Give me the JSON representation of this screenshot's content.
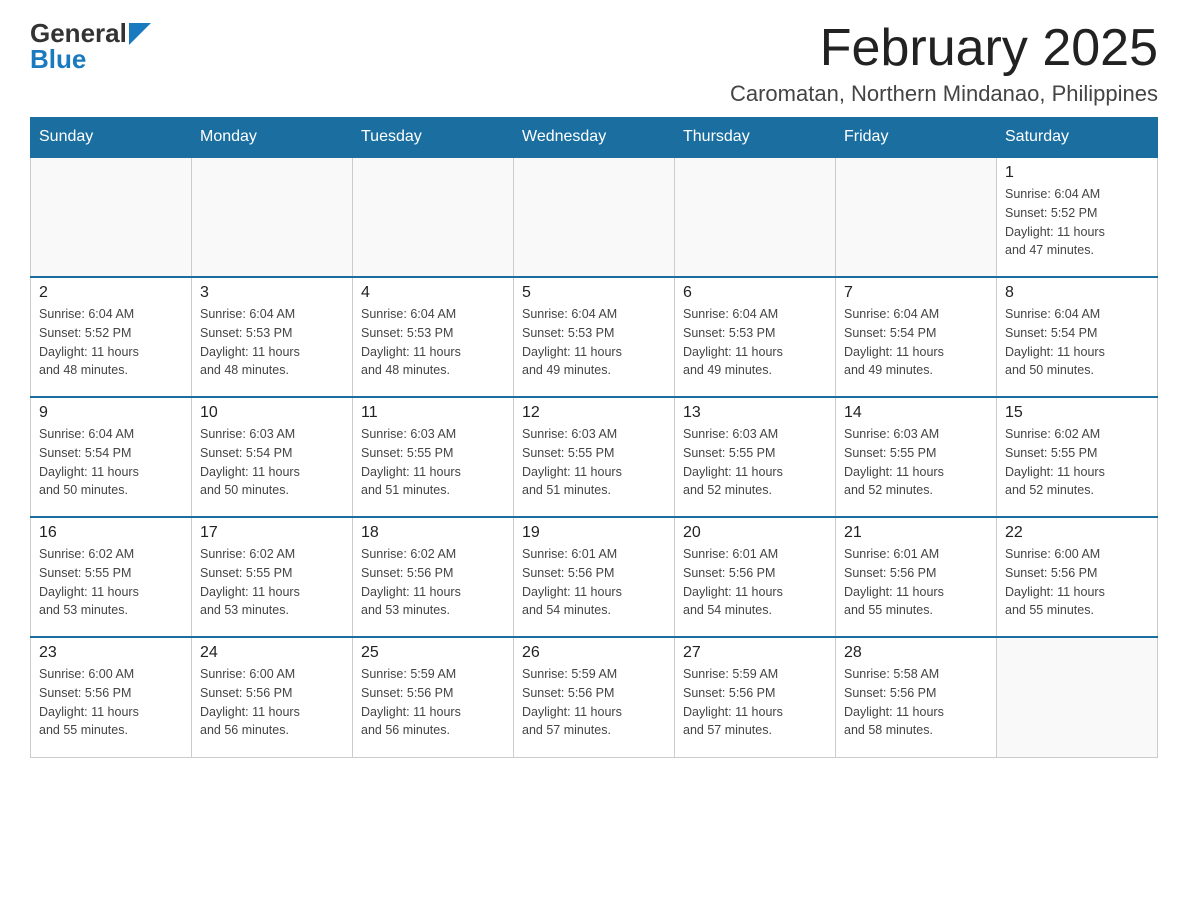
{
  "header": {
    "logo_general": "General",
    "logo_blue": "Blue",
    "month_title": "February 2025",
    "location": "Caromatan, Northern Mindanao, Philippines"
  },
  "weekdays": [
    "Sunday",
    "Monday",
    "Tuesday",
    "Wednesday",
    "Thursday",
    "Friday",
    "Saturday"
  ],
  "weeks": [
    [
      {
        "day": "",
        "info": ""
      },
      {
        "day": "",
        "info": ""
      },
      {
        "day": "",
        "info": ""
      },
      {
        "day": "",
        "info": ""
      },
      {
        "day": "",
        "info": ""
      },
      {
        "day": "",
        "info": ""
      },
      {
        "day": "1",
        "info": "Sunrise: 6:04 AM\nSunset: 5:52 PM\nDaylight: 11 hours\nand 47 minutes."
      }
    ],
    [
      {
        "day": "2",
        "info": "Sunrise: 6:04 AM\nSunset: 5:52 PM\nDaylight: 11 hours\nand 48 minutes."
      },
      {
        "day": "3",
        "info": "Sunrise: 6:04 AM\nSunset: 5:53 PM\nDaylight: 11 hours\nand 48 minutes."
      },
      {
        "day": "4",
        "info": "Sunrise: 6:04 AM\nSunset: 5:53 PM\nDaylight: 11 hours\nand 48 minutes."
      },
      {
        "day": "5",
        "info": "Sunrise: 6:04 AM\nSunset: 5:53 PM\nDaylight: 11 hours\nand 49 minutes."
      },
      {
        "day": "6",
        "info": "Sunrise: 6:04 AM\nSunset: 5:53 PM\nDaylight: 11 hours\nand 49 minutes."
      },
      {
        "day": "7",
        "info": "Sunrise: 6:04 AM\nSunset: 5:54 PM\nDaylight: 11 hours\nand 49 minutes."
      },
      {
        "day": "8",
        "info": "Sunrise: 6:04 AM\nSunset: 5:54 PM\nDaylight: 11 hours\nand 50 minutes."
      }
    ],
    [
      {
        "day": "9",
        "info": "Sunrise: 6:04 AM\nSunset: 5:54 PM\nDaylight: 11 hours\nand 50 minutes."
      },
      {
        "day": "10",
        "info": "Sunrise: 6:03 AM\nSunset: 5:54 PM\nDaylight: 11 hours\nand 50 minutes."
      },
      {
        "day": "11",
        "info": "Sunrise: 6:03 AM\nSunset: 5:55 PM\nDaylight: 11 hours\nand 51 minutes."
      },
      {
        "day": "12",
        "info": "Sunrise: 6:03 AM\nSunset: 5:55 PM\nDaylight: 11 hours\nand 51 minutes."
      },
      {
        "day": "13",
        "info": "Sunrise: 6:03 AM\nSunset: 5:55 PM\nDaylight: 11 hours\nand 52 minutes."
      },
      {
        "day": "14",
        "info": "Sunrise: 6:03 AM\nSunset: 5:55 PM\nDaylight: 11 hours\nand 52 minutes."
      },
      {
        "day": "15",
        "info": "Sunrise: 6:02 AM\nSunset: 5:55 PM\nDaylight: 11 hours\nand 52 minutes."
      }
    ],
    [
      {
        "day": "16",
        "info": "Sunrise: 6:02 AM\nSunset: 5:55 PM\nDaylight: 11 hours\nand 53 minutes."
      },
      {
        "day": "17",
        "info": "Sunrise: 6:02 AM\nSunset: 5:55 PM\nDaylight: 11 hours\nand 53 minutes."
      },
      {
        "day": "18",
        "info": "Sunrise: 6:02 AM\nSunset: 5:56 PM\nDaylight: 11 hours\nand 53 minutes."
      },
      {
        "day": "19",
        "info": "Sunrise: 6:01 AM\nSunset: 5:56 PM\nDaylight: 11 hours\nand 54 minutes."
      },
      {
        "day": "20",
        "info": "Sunrise: 6:01 AM\nSunset: 5:56 PM\nDaylight: 11 hours\nand 54 minutes."
      },
      {
        "day": "21",
        "info": "Sunrise: 6:01 AM\nSunset: 5:56 PM\nDaylight: 11 hours\nand 55 minutes."
      },
      {
        "day": "22",
        "info": "Sunrise: 6:00 AM\nSunset: 5:56 PM\nDaylight: 11 hours\nand 55 minutes."
      }
    ],
    [
      {
        "day": "23",
        "info": "Sunrise: 6:00 AM\nSunset: 5:56 PM\nDaylight: 11 hours\nand 55 minutes."
      },
      {
        "day": "24",
        "info": "Sunrise: 6:00 AM\nSunset: 5:56 PM\nDaylight: 11 hours\nand 56 minutes."
      },
      {
        "day": "25",
        "info": "Sunrise: 5:59 AM\nSunset: 5:56 PM\nDaylight: 11 hours\nand 56 minutes."
      },
      {
        "day": "26",
        "info": "Sunrise: 5:59 AM\nSunset: 5:56 PM\nDaylight: 11 hours\nand 57 minutes."
      },
      {
        "day": "27",
        "info": "Sunrise: 5:59 AM\nSunset: 5:56 PM\nDaylight: 11 hours\nand 57 minutes."
      },
      {
        "day": "28",
        "info": "Sunrise: 5:58 AM\nSunset: 5:56 PM\nDaylight: 11 hours\nand 58 minutes."
      },
      {
        "day": "",
        "info": ""
      }
    ]
  ]
}
